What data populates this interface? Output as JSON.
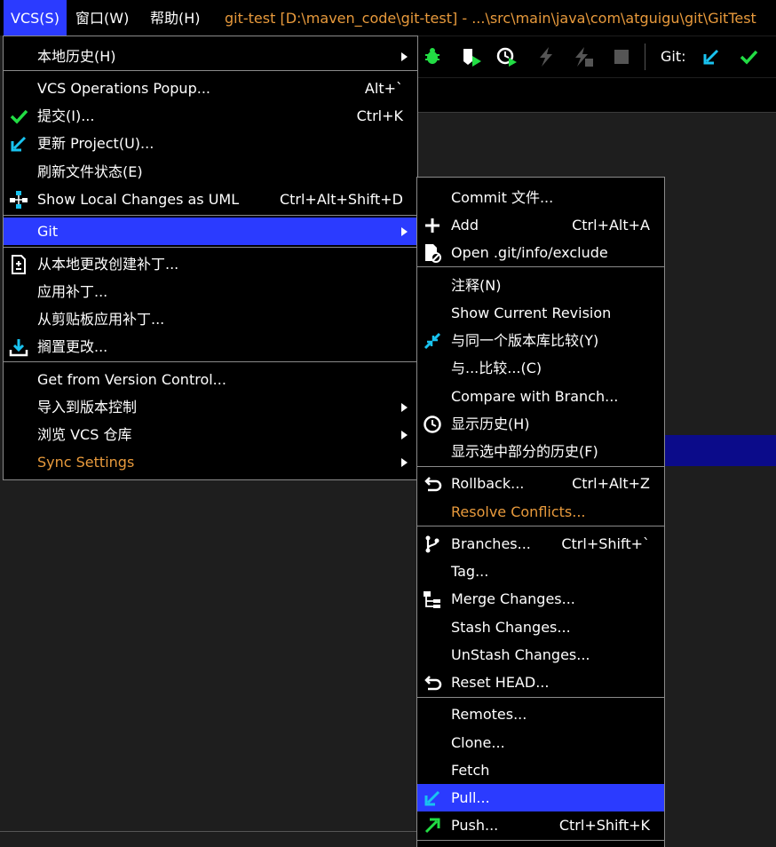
{
  "menubar": {
    "vcs": "VCS(S)",
    "window": "窗口(W)",
    "help": "帮助(H)",
    "title": "git-test [D:\\maven_code\\git-test] - ...\\src\\main\\java\\com\\atguigu\\git\\GitTest"
  },
  "toolbar": {
    "git_label": "Git:",
    "icons": [
      "bug-icon",
      "coverage-run-icon",
      "profiler-run-icon",
      "lightning-icon",
      "lightning-grid-icon",
      "stop-icon",
      "git-update-icon",
      "git-commit-icon"
    ]
  },
  "vcs_menu": {
    "items": [
      {
        "label": "本地历史(H)",
        "shortcut": "",
        "submenu": true
      },
      {
        "label": "VCS Operations Popup...",
        "shortcut": "Alt+`"
      },
      {
        "label": "提交(I)...",
        "shortcut": "Ctrl+K",
        "icon": "check-icon"
      },
      {
        "label": "更新 Project(U)...",
        "shortcut": "",
        "icon": "update-arrow-icon"
      },
      {
        "label": "刷新文件状态(E)",
        "shortcut": ""
      },
      {
        "label": "Show Local Changes as UML",
        "shortcut": "Ctrl+Alt+Shift+D",
        "icon": "uml-icon"
      },
      {
        "label": "Git",
        "shortcut": "",
        "submenu": true
      },
      {
        "label": "从本地更改创建补丁...",
        "shortcut": "",
        "icon": "patch-icon"
      },
      {
        "label": "应用补丁...",
        "shortcut": ""
      },
      {
        "label": "从剪贴板应用补丁...",
        "shortcut": ""
      },
      {
        "label": "搁置更改...",
        "shortcut": "",
        "icon": "shelve-icon"
      },
      {
        "label": "Get from Version Control...",
        "shortcut": ""
      },
      {
        "label": "导入到版本控制",
        "shortcut": "",
        "submenu": true
      },
      {
        "label": "浏览 VCS 仓库",
        "shortcut": "",
        "submenu": true
      },
      {
        "label": "Sync Settings",
        "shortcut": "",
        "submenu": true
      }
    ]
  },
  "git_menu": {
    "items": [
      {
        "label": "Commit 文件..."
      },
      {
        "label": "Add",
        "shortcut": "Ctrl+Alt+A",
        "icon": "plus-icon"
      },
      {
        "label": "Open .git/info/exclude",
        "icon": "exclude-file-icon"
      },
      {
        "label": "注释(N)"
      },
      {
        "label": "Show Current Revision"
      },
      {
        "label": "与同一个版本库比较(Y)",
        "icon": "compare-icon"
      },
      {
        "label": "与...比较...(C)"
      },
      {
        "label": "Compare with Branch..."
      },
      {
        "label": "显示历史(H)",
        "icon": "history-clock-icon"
      },
      {
        "label": "显示选中部分的历史(F)"
      },
      {
        "label": "Rollback...",
        "shortcut": "Ctrl+Alt+Z",
        "icon": "rollback-icon"
      },
      {
        "label": "Resolve Conflicts..."
      },
      {
        "label": "Branches...",
        "shortcut": "Ctrl+Shift+`",
        "icon": "branch-icon"
      },
      {
        "label": "Tag..."
      },
      {
        "label": "Merge Changes...",
        "icon": "merge-icon"
      },
      {
        "label": "Stash Changes..."
      },
      {
        "label": "UnStash Changes..."
      },
      {
        "label": "Reset HEAD...",
        "icon": "reset-icon"
      },
      {
        "label": "Remotes..."
      },
      {
        "label": "Clone..."
      },
      {
        "label": "Fetch"
      },
      {
        "label": "Pull...",
        "icon": "pull-arrow-icon"
      },
      {
        "label": "Push...",
        "shortcut": "Ctrl+Shift+K",
        "icon": "push-arrow-icon"
      }
    ]
  },
  "colors": {
    "highlight": "#2b3bff",
    "orange_text": "#e89a3c",
    "check_green": "#22dd44",
    "arrow_cyan": "#19c3f0"
  }
}
